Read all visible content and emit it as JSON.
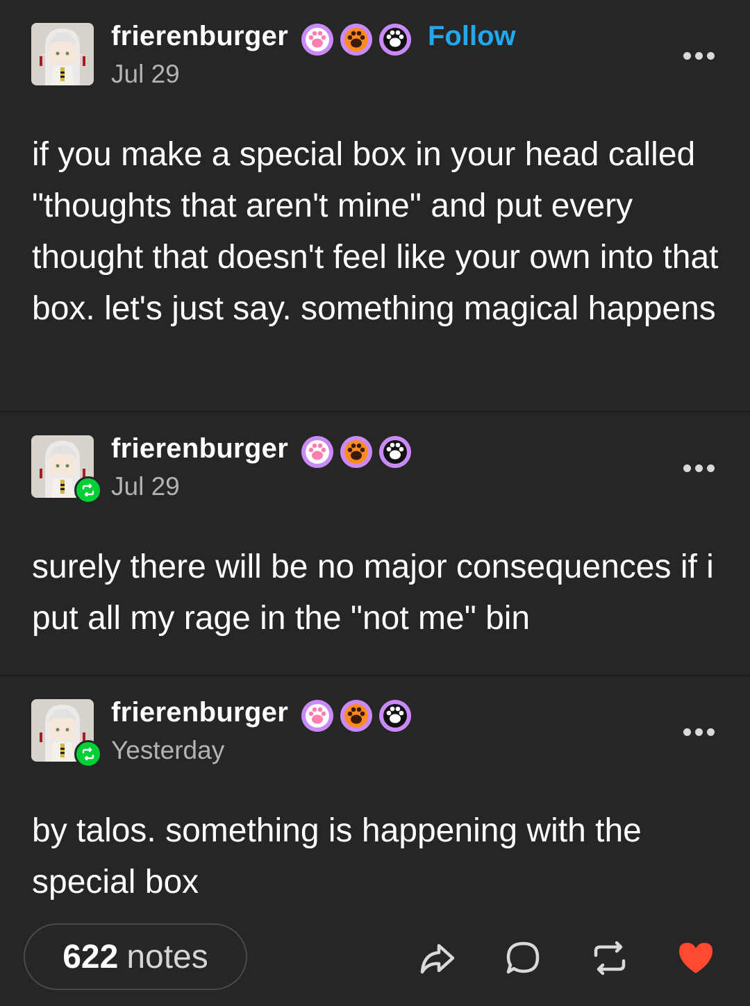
{
  "posts": [
    {
      "username": "frierenburger",
      "follow_label": "Follow",
      "date": "Jul 29",
      "body": "if you make a special box in your head called \"thoughts that aren't mine\" and put every thought that doesn't feel like your own into that box. let's just say. something magical happens"
    },
    {
      "username": "frierenburger",
      "date": "Jul 29",
      "body": "surely there will be no major consequences if i put all my rage in the \"not me\" bin"
    },
    {
      "username": "frierenburger",
      "date": "Yesterday",
      "body": "by talos. something is happening with the special box"
    }
  ],
  "badges": [
    {
      "icon": "paw-pink-icon",
      "bg": "#c78af5",
      "paw": "#ff7fb0"
    },
    {
      "icon": "paw-orange-icon",
      "bg": "#c78af5",
      "paw": "#ff8a1f"
    },
    {
      "icon": "paw-black-icon",
      "bg": "#c78af5",
      "paw": "#111111"
    }
  ],
  "footer": {
    "notes_count": "622",
    "notes_label": "notes",
    "actions": [
      "share-icon",
      "reply-icon",
      "reblog-icon",
      "like-heart-icon"
    ]
  },
  "colors": {
    "background": "#262626",
    "follow": "#1ea9f0",
    "reblog_badge": "#00cf35",
    "heart": "#ff4930"
  }
}
